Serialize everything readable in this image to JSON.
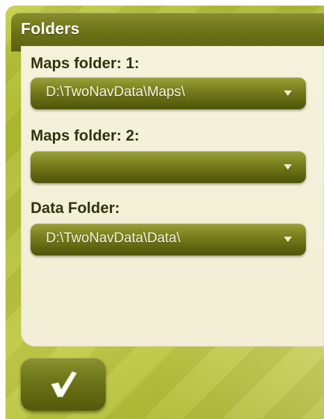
{
  "panel": {
    "title": "Folders"
  },
  "fields": [
    {
      "label": "Maps folder: 1:",
      "value": "D:\\TwoNavData\\Maps\\"
    },
    {
      "label": "Maps folder: 2:",
      "value": ""
    },
    {
      "label": "Data Folder:",
      "value": "D:\\TwoNavData\\Data\\"
    }
  ],
  "icons": {
    "dropdown": "chevron-down-icon",
    "confirm": "checkmark-icon"
  },
  "colors": {
    "background_green": "#b4c13a",
    "header_olive": "#6e7519",
    "panel_cream": "#f3f0d8",
    "label_text": "#33330f"
  }
}
